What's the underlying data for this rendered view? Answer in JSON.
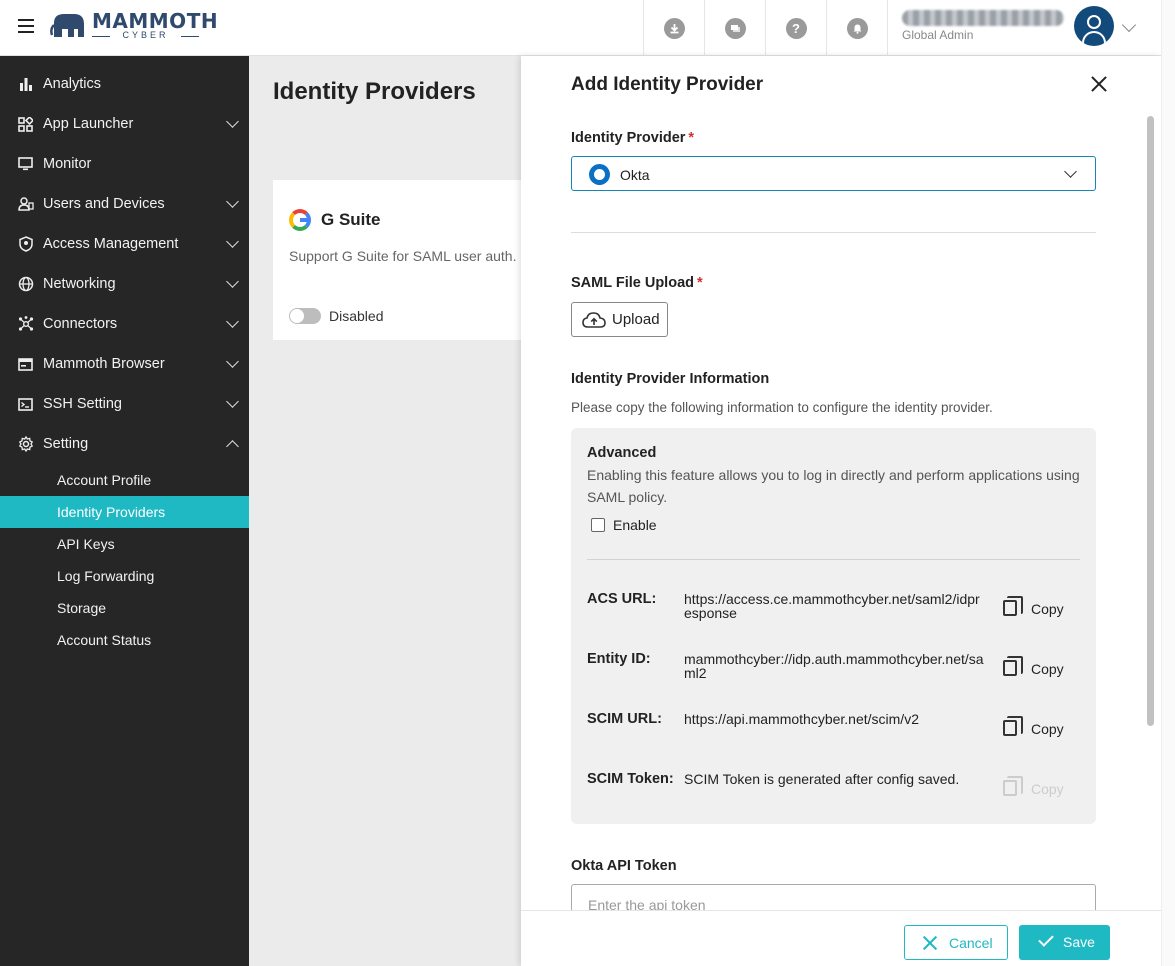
{
  "header": {
    "logo_text": "MAMMOTH",
    "logo_sub": "CYBER",
    "user_role": "Global Admin",
    "icons": [
      "download-icon",
      "chat-icon",
      "help-icon",
      "bell-icon"
    ]
  },
  "sidebar": {
    "items": [
      {
        "label": "Analytics",
        "icon": "bar-chart-icon"
      },
      {
        "label": "App Launcher",
        "icon": "apps-icon"
      },
      {
        "label": "Monitor",
        "icon": "monitor-icon"
      },
      {
        "label": "Users and Devices",
        "icon": "users-icon"
      },
      {
        "label": "Access Management",
        "icon": "shield-icon"
      },
      {
        "label": "Networking",
        "icon": "globe-icon"
      },
      {
        "label": "Connectors",
        "icon": "hub-icon"
      },
      {
        "label": "Mammoth Browser",
        "icon": "browser-icon"
      },
      {
        "label": "SSH Setting",
        "icon": "terminal-icon"
      },
      {
        "label": "Setting",
        "icon": "gear-icon"
      }
    ],
    "sub_items": [
      "Account Profile",
      "Identity Providers",
      "API Keys",
      "Log Forwarding",
      "Storage",
      "Account Status"
    ],
    "active_sub": "Identity Providers",
    "accent": "#1fb9c4"
  },
  "main": {
    "title": "Identity Providers",
    "card": {
      "title": "G Suite",
      "description": "Support G Suite for SAML user auth.",
      "status": "Disabled"
    }
  },
  "drawer": {
    "title": "Add Identity Provider",
    "provider_label": "Identity Provider",
    "provider_value": "Okta",
    "saml_label": "SAML File Upload",
    "upload_label": "Upload",
    "info_title": "Identity Provider Information",
    "info_desc": "Please copy the following information to configure the identity provider.",
    "advanced": {
      "title": "Advanced",
      "description": "Enabling this feature allows you to log in directly and perform applications using SAML policy.",
      "checkbox_label": "Enable",
      "checked": false
    },
    "fields": [
      {
        "key": "ACS URL:",
        "value": "https://access.ce.mammothcyber.net/saml2/idpresponse",
        "copy": "Copy",
        "enabled": true
      },
      {
        "key": "Entity ID:",
        "value": "mammothcyber://idp.auth.mammothcyber.net/saml2",
        "copy": "Copy",
        "enabled": true
      },
      {
        "key": "SCIM URL:",
        "value": "https://api.mammothcyber.net/scim/v2",
        "copy": "Copy",
        "enabled": true
      },
      {
        "key": "SCIM Token:",
        "value": "SCIM Token is generated after config saved.",
        "copy": "Copy",
        "enabled": false
      }
    ],
    "token_label": "Okta API Token",
    "token_placeholder": "Enter the api token",
    "cancel_label": "Cancel",
    "save_label": "Save"
  }
}
